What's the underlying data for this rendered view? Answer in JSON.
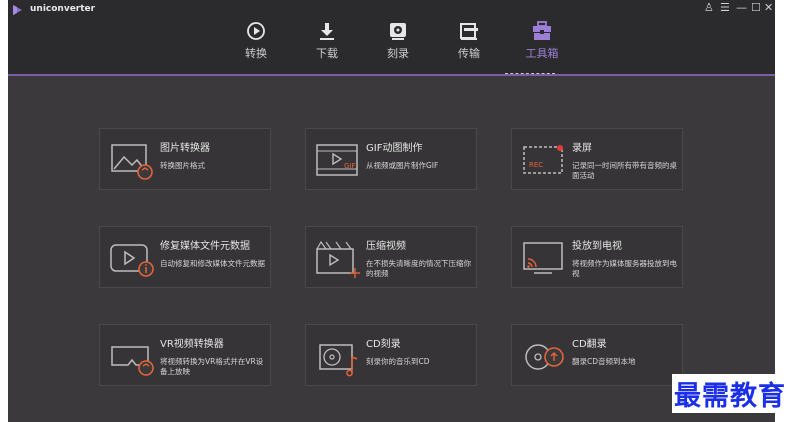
{
  "app": {
    "title": "uniconverter"
  },
  "window_controls": {
    "user": "♙",
    "menu": "☰",
    "minimize": "—",
    "maximize": "☐",
    "close": "✕"
  },
  "nav": [
    {
      "label": "转换",
      "icon": "convert-icon",
      "active": false
    },
    {
      "label": "下载",
      "icon": "download-icon",
      "active": false
    },
    {
      "label": "刻录",
      "icon": "burn-icon",
      "active": false
    },
    {
      "label": "传输",
      "icon": "transfer-icon",
      "active": false
    },
    {
      "label": "工具箱",
      "icon": "toolbox-icon",
      "active": true
    }
  ],
  "tools": [
    {
      "title": "图片转换器",
      "desc": "转换图片格式",
      "icon": "image-convert-icon"
    },
    {
      "title": "GIF动图制作",
      "desc": "从视频或图片制作GIF",
      "icon": "gif-maker-icon",
      "badge": "GIF"
    },
    {
      "title": "录屏",
      "desc": "记录同一时间所有带有音频的桌面活动",
      "icon": "screen-record-icon",
      "badge": "REC"
    },
    {
      "title": "修复媒体文件元数据",
      "desc": "自动修复和修改媒体文件元数据",
      "icon": "metadata-fix-icon"
    },
    {
      "title": "压缩视频",
      "desc": "在不损失清晰度的情况下压缩你的视频",
      "icon": "compress-video-icon"
    },
    {
      "title": "投放到电视",
      "desc": "将视频作为媒体服务器投放到电视",
      "icon": "cast-tv-icon"
    },
    {
      "title": "VR视频转换器",
      "desc": "将视频转换为VR格式并在VR设备上放映",
      "icon": "vr-convert-icon"
    },
    {
      "title": "CD刻录",
      "desc": "刻录你的音乐到CD",
      "icon": "cd-burn-icon"
    },
    {
      "title": "CD翻录",
      "desc": "翻录CD音频到本地",
      "icon": "cd-rip-icon"
    }
  ],
  "watermark": "最需教育",
  "colors": {
    "accent": "#9b7fd6",
    "background": "#3b393b",
    "topbar": "#2b2a2c",
    "card": "#363436",
    "record_dot": "#e23b3b",
    "icon_accent": "#e0643a"
  }
}
